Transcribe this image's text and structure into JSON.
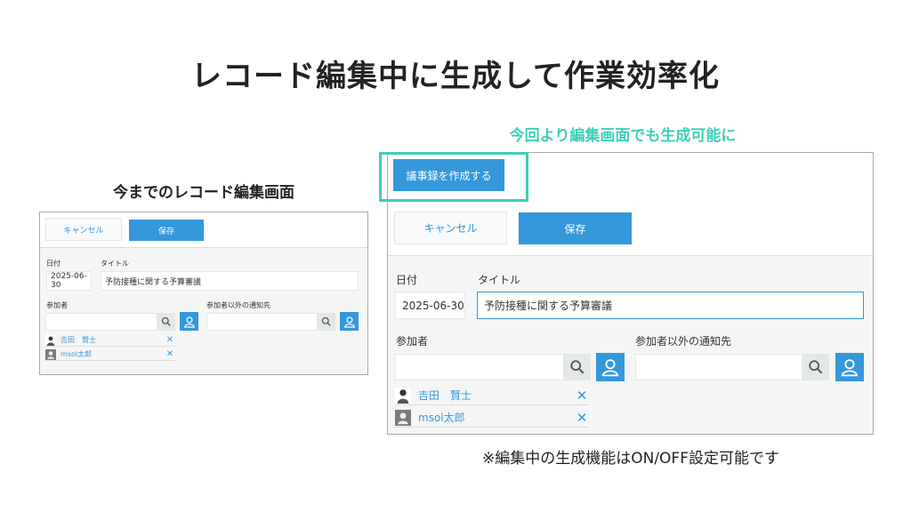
{
  "slide": {
    "title": "レコード編集中に生成して作業効率化",
    "left_label": "今までのレコード編集画面",
    "highlight_label": "今回より編集画面でも生成可能に",
    "footnote": "※編集中の生成機能はON/OFF設定可能です"
  },
  "form": {
    "minutes_button": "議事録を作成する",
    "cancel_label": "キャンセル",
    "save_label": "保存",
    "date_label": "日付",
    "date_value": "2025-06-30",
    "title_label": "タイトル",
    "title_value": "予防接種に関する予算審議",
    "participants_label": "参加者",
    "notify_label": "参加者以外の通知先",
    "participants": [
      {
        "name": "吉田　賢士",
        "avatar": "person-photo-icon"
      },
      {
        "name": "msol太郎",
        "avatar": "default-user-icon"
      }
    ],
    "remove_symbol": "✕"
  },
  "colors": {
    "accent": "#3498db",
    "highlight": "#3dcfb8",
    "panel_bg": "#f5f5f5"
  }
}
